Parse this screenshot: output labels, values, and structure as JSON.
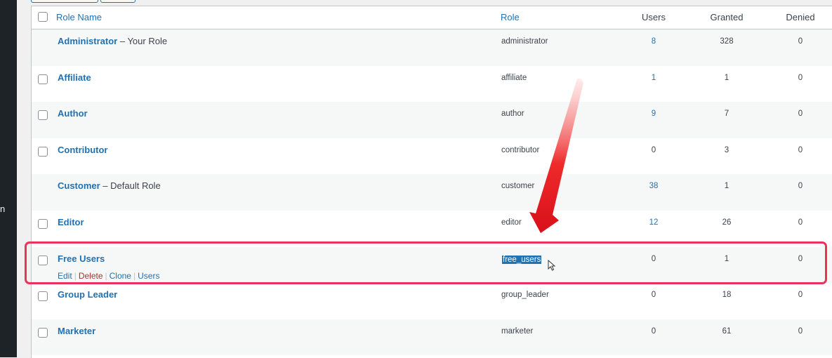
{
  "sidebar": {
    "fragment": "n"
  },
  "columns": {
    "role_name": "Role Name",
    "role": "Role",
    "users": "Users",
    "granted": "Granted",
    "denied": "Denied"
  },
  "rows": [
    {
      "name": "Administrator",
      "suffix": " – Your Role",
      "slug": "administrator",
      "users": "8",
      "granted": "328",
      "denied": "0",
      "has_checkbox": false,
      "alt": true
    },
    {
      "name": "Affiliate",
      "suffix": "",
      "slug": "affiliate",
      "users": "1",
      "granted": "1",
      "denied": "0",
      "has_checkbox": true,
      "alt": false
    },
    {
      "name": "Author",
      "suffix": "",
      "slug": "author",
      "users": "9",
      "granted": "7",
      "denied": "0",
      "has_checkbox": true,
      "alt": true
    },
    {
      "name": "Contributor",
      "suffix": "",
      "slug": "contributor",
      "users": "0",
      "granted": "3",
      "denied": "0",
      "has_checkbox": true,
      "alt": false
    },
    {
      "name": "Customer",
      "suffix": " – Default Role",
      "slug": "customer",
      "users": "38",
      "granted": "1",
      "denied": "0",
      "has_checkbox": false,
      "alt": true
    },
    {
      "name": "Editor",
      "suffix": "",
      "slug": "editor",
      "users": "12",
      "granted": "26",
      "denied": "0",
      "has_checkbox": true,
      "alt": false
    },
    {
      "name": "Free Users",
      "suffix": "",
      "slug": "free_users",
      "users": "0",
      "granted": "1",
      "denied": "0",
      "has_checkbox": true,
      "alt": true,
      "selected": true,
      "actions": [
        "Edit",
        "Delete",
        "Clone",
        "Users"
      ]
    },
    {
      "name": "Group Leader",
      "suffix": "",
      "slug": "group_leader",
      "users": "0",
      "granted": "18",
      "denied": "0",
      "has_checkbox": true,
      "alt": false
    },
    {
      "name": "Marketer",
      "suffix": "",
      "slug": "marketer",
      "users": "0",
      "granted": "61",
      "denied": "0",
      "has_checkbox": true,
      "alt": true
    }
  ],
  "colors": {
    "link": "#2271b1",
    "delete": "#b32d2e",
    "highlight": "#e8345a",
    "arrow": "#e3161d"
  }
}
